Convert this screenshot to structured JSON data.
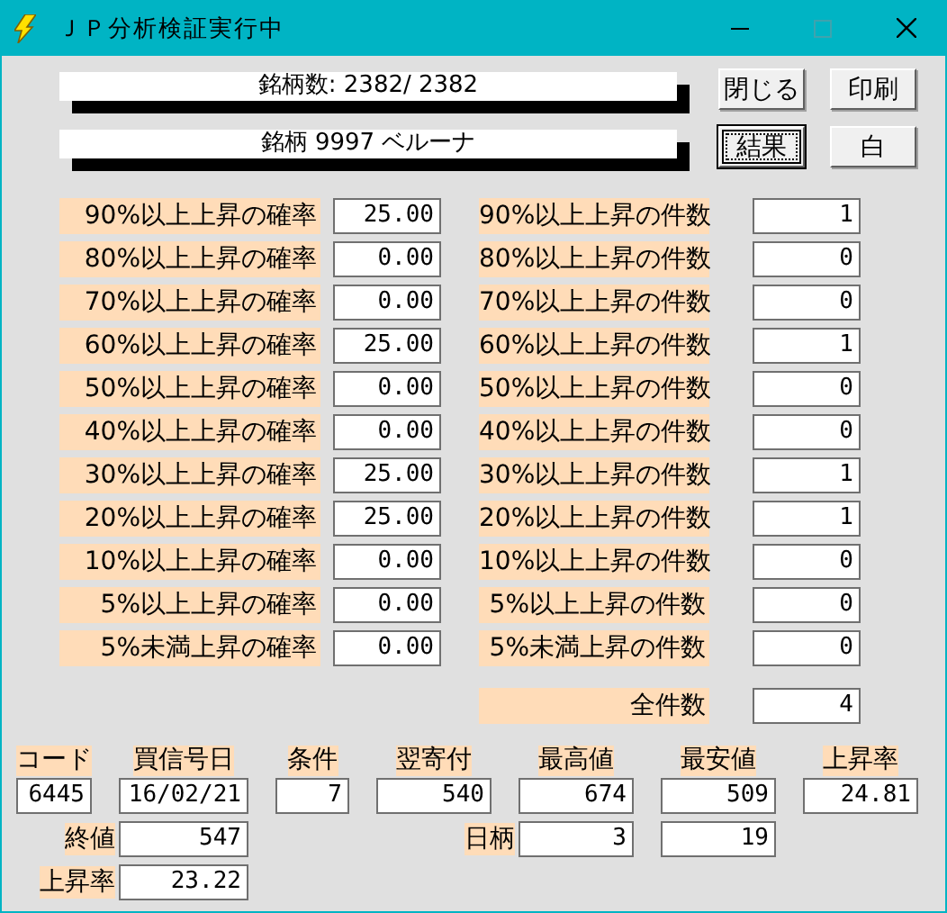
{
  "window": {
    "title": "ＪＰ分析検証実行中",
    "maximize_disabled": true
  },
  "status_lines": [
    "銘柄数: 2382/ 2382",
    "銘柄 9997 ベルーナ"
  ],
  "buttons": [
    {
      "label": "閉じる",
      "focused": false
    },
    {
      "label": "印刷",
      "focused": false
    },
    {
      "label": "結果",
      "focused": true
    },
    {
      "label": "白",
      "focused": false
    }
  ],
  "probabilities": [
    {
      "label": "90%以上上昇の確率",
      "value": "25.00"
    },
    {
      "label": "80%以上上昇の確率",
      "value": "0.00"
    },
    {
      "label": "70%以上上昇の確率",
      "value": "0.00"
    },
    {
      "label": "60%以上上昇の確率",
      "value": "25.00"
    },
    {
      "label": "50%以上上昇の確率",
      "value": "0.00"
    },
    {
      "label": "40%以上上昇の確率",
      "value": "0.00"
    },
    {
      "label": "30%以上上昇の確率",
      "value": "25.00"
    },
    {
      "label": "20%以上上昇の確率",
      "value": "25.00"
    },
    {
      "label": "10%以上上昇の確率",
      "value": "0.00"
    },
    {
      "label": "5%以上上昇の確率",
      "value": "0.00"
    },
    {
      "label": "5%未満上昇の確率",
      "value": "0.00"
    }
  ],
  "counts": [
    {
      "label": "90%以上上昇の件数",
      "value": "1"
    },
    {
      "label": "80%以上上昇の件数",
      "value": "0"
    },
    {
      "label": "70%以上上昇の件数",
      "value": "0"
    },
    {
      "label": "60%以上上昇の件数",
      "value": "1"
    },
    {
      "label": "50%以上上昇の件数",
      "value": "0"
    },
    {
      "label": "40%以上上昇の件数",
      "value": "0"
    },
    {
      "label": "30%以上上昇の件数",
      "value": "1"
    },
    {
      "label": "20%以上上昇の件数",
      "value": "1"
    },
    {
      "label": "10%以上上昇の件数",
      "value": "0"
    },
    {
      "label": "5%以上上昇の件数",
      "value": "0"
    },
    {
      "label": "5%未満上昇の件数",
      "value": "0"
    }
  ],
  "total": {
    "label": "全件数",
    "value": "4"
  },
  "detail_columns": [
    {
      "header": "コード",
      "value": "6445"
    },
    {
      "header": "買信号日",
      "value": "16/02/21"
    },
    {
      "header": "条件",
      "value": "7"
    },
    {
      "header": "翌寄付",
      "value": "540"
    },
    {
      "header": "最高値",
      "value": "674"
    },
    {
      "header": "最安値",
      "value": "509"
    },
    {
      "header": "上昇率",
      "value": "24.81"
    }
  ],
  "close_price": {
    "label": "終値",
    "value": "547"
  },
  "days": {
    "label": "日柄",
    "values": [
      "3",
      "19"
    ]
  },
  "rise_rate": {
    "label": "上昇率",
    "value": "23.22"
  }
}
